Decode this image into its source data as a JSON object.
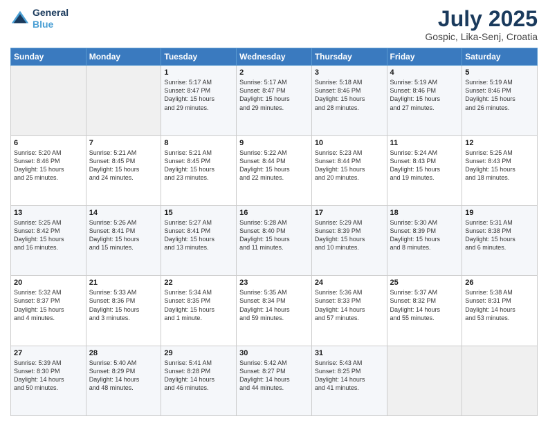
{
  "header": {
    "logo_line1": "General",
    "logo_line2": "Blue",
    "month": "July 2025",
    "location": "Gospic, Lika-Senj, Croatia"
  },
  "days_of_week": [
    "Sunday",
    "Monday",
    "Tuesday",
    "Wednesday",
    "Thursday",
    "Friday",
    "Saturday"
  ],
  "weeks": [
    [
      {
        "day": "",
        "content": ""
      },
      {
        "day": "",
        "content": ""
      },
      {
        "day": "1",
        "content": "Sunrise: 5:17 AM\nSunset: 8:47 PM\nDaylight: 15 hours\nand 29 minutes."
      },
      {
        "day": "2",
        "content": "Sunrise: 5:17 AM\nSunset: 8:47 PM\nDaylight: 15 hours\nand 29 minutes."
      },
      {
        "day": "3",
        "content": "Sunrise: 5:18 AM\nSunset: 8:46 PM\nDaylight: 15 hours\nand 28 minutes."
      },
      {
        "day": "4",
        "content": "Sunrise: 5:19 AM\nSunset: 8:46 PM\nDaylight: 15 hours\nand 27 minutes."
      },
      {
        "day": "5",
        "content": "Sunrise: 5:19 AM\nSunset: 8:46 PM\nDaylight: 15 hours\nand 26 minutes."
      }
    ],
    [
      {
        "day": "6",
        "content": "Sunrise: 5:20 AM\nSunset: 8:46 PM\nDaylight: 15 hours\nand 25 minutes."
      },
      {
        "day": "7",
        "content": "Sunrise: 5:21 AM\nSunset: 8:45 PM\nDaylight: 15 hours\nand 24 minutes."
      },
      {
        "day": "8",
        "content": "Sunrise: 5:21 AM\nSunset: 8:45 PM\nDaylight: 15 hours\nand 23 minutes."
      },
      {
        "day": "9",
        "content": "Sunrise: 5:22 AM\nSunset: 8:44 PM\nDaylight: 15 hours\nand 22 minutes."
      },
      {
        "day": "10",
        "content": "Sunrise: 5:23 AM\nSunset: 8:44 PM\nDaylight: 15 hours\nand 20 minutes."
      },
      {
        "day": "11",
        "content": "Sunrise: 5:24 AM\nSunset: 8:43 PM\nDaylight: 15 hours\nand 19 minutes."
      },
      {
        "day": "12",
        "content": "Sunrise: 5:25 AM\nSunset: 8:43 PM\nDaylight: 15 hours\nand 18 minutes."
      }
    ],
    [
      {
        "day": "13",
        "content": "Sunrise: 5:25 AM\nSunset: 8:42 PM\nDaylight: 15 hours\nand 16 minutes."
      },
      {
        "day": "14",
        "content": "Sunrise: 5:26 AM\nSunset: 8:41 PM\nDaylight: 15 hours\nand 15 minutes."
      },
      {
        "day": "15",
        "content": "Sunrise: 5:27 AM\nSunset: 8:41 PM\nDaylight: 15 hours\nand 13 minutes."
      },
      {
        "day": "16",
        "content": "Sunrise: 5:28 AM\nSunset: 8:40 PM\nDaylight: 15 hours\nand 11 minutes."
      },
      {
        "day": "17",
        "content": "Sunrise: 5:29 AM\nSunset: 8:39 PM\nDaylight: 15 hours\nand 10 minutes."
      },
      {
        "day": "18",
        "content": "Sunrise: 5:30 AM\nSunset: 8:39 PM\nDaylight: 15 hours\nand 8 minutes."
      },
      {
        "day": "19",
        "content": "Sunrise: 5:31 AM\nSunset: 8:38 PM\nDaylight: 15 hours\nand 6 minutes."
      }
    ],
    [
      {
        "day": "20",
        "content": "Sunrise: 5:32 AM\nSunset: 8:37 PM\nDaylight: 15 hours\nand 4 minutes."
      },
      {
        "day": "21",
        "content": "Sunrise: 5:33 AM\nSunset: 8:36 PM\nDaylight: 15 hours\nand 3 minutes."
      },
      {
        "day": "22",
        "content": "Sunrise: 5:34 AM\nSunset: 8:35 PM\nDaylight: 15 hours\nand 1 minute."
      },
      {
        "day": "23",
        "content": "Sunrise: 5:35 AM\nSunset: 8:34 PM\nDaylight: 14 hours\nand 59 minutes."
      },
      {
        "day": "24",
        "content": "Sunrise: 5:36 AM\nSunset: 8:33 PM\nDaylight: 14 hours\nand 57 minutes."
      },
      {
        "day": "25",
        "content": "Sunrise: 5:37 AM\nSunset: 8:32 PM\nDaylight: 14 hours\nand 55 minutes."
      },
      {
        "day": "26",
        "content": "Sunrise: 5:38 AM\nSunset: 8:31 PM\nDaylight: 14 hours\nand 53 minutes."
      }
    ],
    [
      {
        "day": "27",
        "content": "Sunrise: 5:39 AM\nSunset: 8:30 PM\nDaylight: 14 hours\nand 50 minutes."
      },
      {
        "day": "28",
        "content": "Sunrise: 5:40 AM\nSunset: 8:29 PM\nDaylight: 14 hours\nand 48 minutes."
      },
      {
        "day": "29",
        "content": "Sunrise: 5:41 AM\nSunset: 8:28 PM\nDaylight: 14 hours\nand 46 minutes."
      },
      {
        "day": "30",
        "content": "Sunrise: 5:42 AM\nSunset: 8:27 PM\nDaylight: 14 hours\nand 44 minutes."
      },
      {
        "day": "31",
        "content": "Sunrise: 5:43 AM\nSunset: 8:25 PM\nDaylight: 14 hours\nand 41 minutes."
      },
      {
        "day": "",
        "content": ""
      },
      {
        "day": "",
        "content": ""
      }
    ]
  ]
}
